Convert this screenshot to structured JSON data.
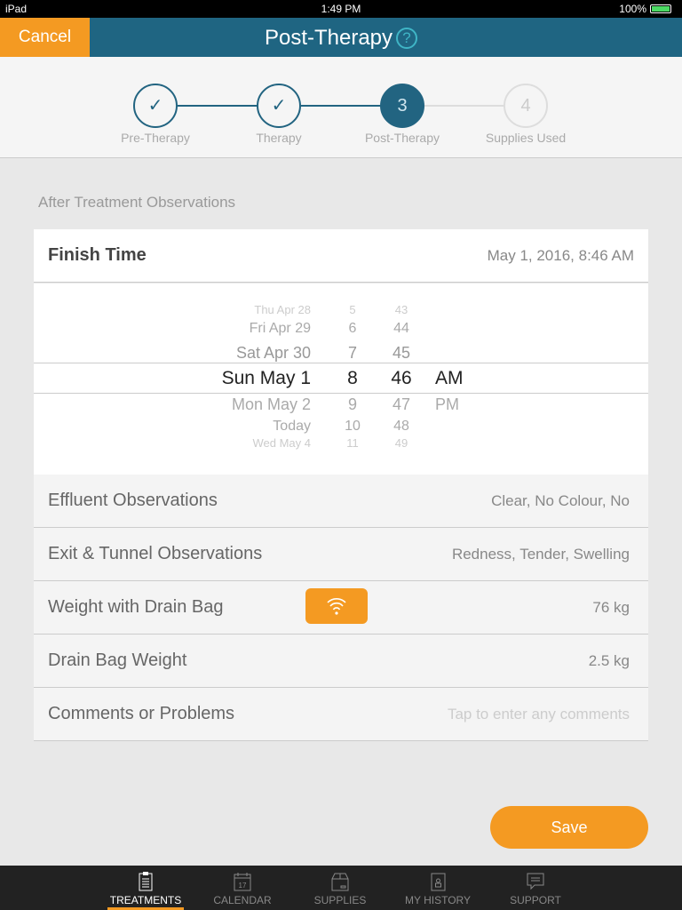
{
  "status_bar": {
    "device": "iPad",
    "time": "1:49 PM",
    "battery": "100%"
  },
  "nav": {
    "cancel_label": "Cancel",
    "title": "Post-Therapy",
    "help_icon": "?"
  },
  "stepper": {
    "steps": [
      {
        "label": "Pre-Therapy",
        "marker": "✓",
        "state": "done"
      },
      {
        "label": "Therapy",
        "marker": "✓",
        "state": "done"
      },
      {
        "label": "Post-Therapy",
        "marker": "3",
        "state": "active"
      },
      {
        "label": "Supplies Used",
        "marker": "4",
        "state": "future"
      }
    ]
  },
  "section_title": "After Treatment Observations",
  "finish_time": {
    "label": "Finish Time",
    "value": "May 1, 2016, 8:46 AM"
  },
  "picker": {
    "rows": [
      {
        "date": "Thu Apr 28",
        "hour": "5",
        "minute": "43",
        "ampm": ""
      },
      {
        "date": "Fri Apr 29",
        "hour": "6",
        "minute": "44",
        "ampm": ""
      },
      {
        "date": "Sat Apr 30",
        "hour": "7",
        "minute": "45",
        "ampm": ""
      },
      {
        "date": "Sun May 1",
        "hour": "8",
        "minute": "46",
        "ampm": "AM"
      },
      {
        "date": "Mon May 2",
        "hour": "9",
        "minute": "47",
        "ampm": "PM"
      },
      {
        "date": "Today",
        "hour": "10",
        "minute": "48",
        "ampm": ""
      },
      {
        "date": "Wed May 4",
        "hour": "11",
        "minute": "49",
        "ampm": ""
      }
    ],
    "selected_index": 3
  },
  "rows": [
    {
      "label": "Effluent Observations",
      "value": "Clear, No Colour, No"
    },
    {
      "label": "Exit & Tunnel Observations",
      "value": "Redness, Tender, Swelling"
    },
    {
      "label": "Weight with Drain Bag",
      "value": "76 kg"
    },
    {
      "label": "Drain Bag Weight",
      "value": "2.5 kg"
    },
    {
      "label": "Comments or Problems",
      "placeholder": "Tap to enter any comments"
    }
  ],
  "save_label": "Save",
  "tabs": [
    {
      "label": "TREATMENTS",
      "icon": "clipboard-icon",
      "active": true
    },
    {
      "label": "CALENDAR",
      "icon": "calendar-icon"
    },
    {
      "label": "SUPPLIES",
      "icon": "box-icon"
    },
    {
      "label": "MY HISTORY",
      "icon": "history-book-icon"
    },
    {
      "label": "SUPPORT",
      "icon": "chat-icon"
    }
  ],
  "colors": {
    "accent": "#f49a22",
    "primary": "#1f6582"
  }
}
